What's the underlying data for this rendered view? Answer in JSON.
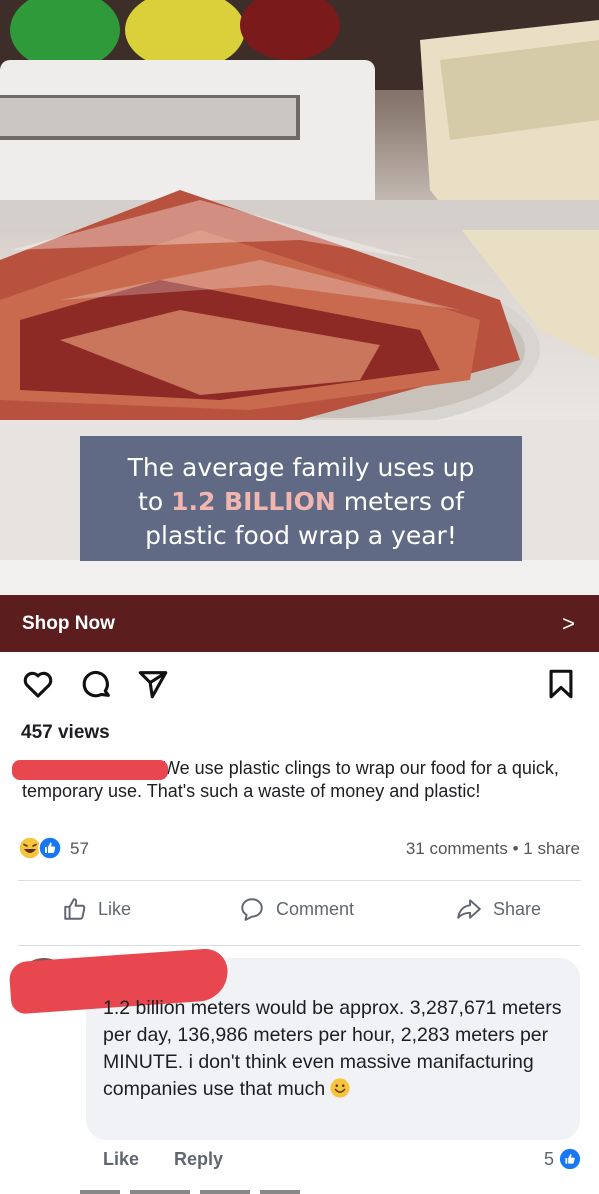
{
  "ad": {
    "caption_pre": "The average family uses up",
    "caption_line2_pre": "to ",
    "caption_highlight": "1.2 BILLION",
    "caption_line2_post": " meters of",
    "caption_line3": "plastic food wrap a year!",
    "cta_label": "Shop Now",
    "cta_chevron": ">"
  },
  "post": {
    "views": "457 views",
    "caption": "We use plastic clings to wrap our food for a quick, temporary use. That's such a waste of money and plastic!",
    "reaction_count": "57",
    "comments_share": "31 comments • 1 share"
  },
  "action_bar": {
    "like": "Like",
    "comment": "Comment",
    "share": "Share"
  },
  "comment": {
    "text": "1.2 billion meters would be approx. 3,287,671 meters per day, 136,986 meters per hour, 2,283 meters per MINUTE. i don't think even massive manifacturing companies use that much",
    "like_label": "Like",
    "reply_label": "Reply",
    "like_count": "5"
  },
  "colors": {
    "cta_bar": "#5b1d1e",
    "caption_box": "#56607c",
    "highlight": "#f2b6b1",
    "fb_blue": "#1877f2",
    "redaction": "#e8474f"
  },
  "icons": [
    "heart-icon",
    "comment-bubble-icon",
    "send-icon",
    "bookmark-icon",
    "like-thumb-icon",
    "comment-icon",
    "share-arrow-icon",
    "haha-emoji-icon",
    "like-reaction-icon",
    "smile-emoji-icon"
  ]
}
